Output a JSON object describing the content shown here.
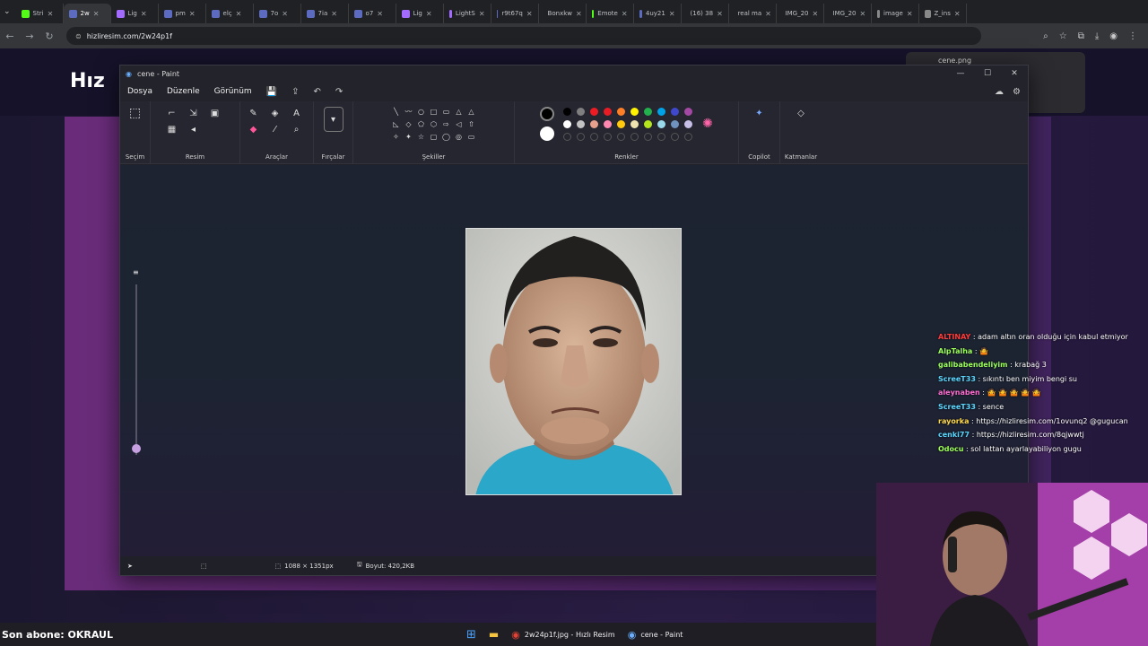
{
  "browser": {
    "tabs": [
      {
        "label": "Stri",
        "color": "#53fc18"
      },
      {
        "label": "2w",
        "color": "#5c6bc0",
        "active": true
      },
      {
        "label": "Lig",
        "color": "#a36bff"
      },
      {
        "label": "pm",
        "color": "#5c6bc0"
      },
      {
        "label": "elç",
        "color": "#5c6bc0"
      },
      {
        "label": "7o",
        "color": "#5c6bc0"
      },
      {
        "label": "7ia",
        "color": "#5c6bc0"
      },
      {
        "label": "o7",
        "color": "#5c6bc0"
      },
      {
        "label": "Lig",
        "color": "#a36bff"
      },
      {
        "label": "LightS",
        "color": "#a36bff"
      },
      {
        "label": "r9t67q",
        "color": "#5c6bc0"
      },
      {
        "label": "Bonxkw",
        "color": "#5c6bc0"
      },
      {
        "label": "Emote",
        "color": "#53fc18"
      },
      {
        "label": "4uy21",
        "color": "#5c6bc0"
      },
      {
        "label": "(16) 38",
        "color": "#ff0000"
      },
      {
        "label": "real ma",
        "color": "#ffffff"
      },
      {
        "label": "IMG_20",
        "color": "#888888"
      },
      {
        "label": "IMG_20",
        "color": "#888888"
      },
      {
        "label": "image",
        "color": "#888888"
      },
      {
        "label": "Z_ins",
        "color": "#888888"
      }
    ],
    "url": "hizliresim.com/2w24p1f"
  },
  "site": {
    "logo_text": "Hız",
    "download_file": "cene.png"
  },
  "paint": {
    "title": "cene - Paint",
    "menu": [
      "Dosya",
      "Düzenle",
      "Görünüm"
    ],
    "groups": {
      "selection": "Seçim",
      "image": "Resim",
      "tools": "Araçlar",
      "brushes": "Fırçalar",
      "shapes": "Şekiller",
      "colors": "Renkler",
      "copilot": "Copilot",
      "layers": "Katmanlar"
    },
    "palette_row1": [
      "#000000",
      "#7f7f7f",
      "#ed1c24",
      "#e81c24",
      "#ff7f27",
      "#fff200",
      "#22b14c",
      "#00a2e8",
      "#3f48cc",
      "#a349a4"
    ],
    "palette_row2": [
      "#ffffff",
      "#c3c3c3",
      "#e6a08c",
      "#ff88b0",
      "#ffc90e",
      "#efe4b0",
      "#b5e61d",
      "#99d9ea",
      "#7092be",
      "#c8bfe7"
    ],
    "status": {
      "dimensions": "1088 × 1351px",
      "size": "Boyut: 420,2KB"
    }
  },
  "chat": [
    {
      "user": "ALTINAY",
      "color": "#ff3b3b",
      "msg": ": adam altın oran olduğu için kabul etmiyor"
    },
    {
      "user": "AlpTalha",
      "color": "#9cff5a",
      "msg": ": 🤷"
    },
    {
      "user": "galibabendeliyim",
      "color": "#9cff5a",
      "msg": ": krabağ 3"
    },
    {
      "user": "ScreeT33",
      "color": "#5ad7ff",
      "msg": ": sıkıntı ben miyim bengi su"
    },
    {
      "user": "aleynaben",
      "color": "#ff6fd2",
      "msg": ": 🤷 🤷 🤷 🤷 🤷"
    },
    {
      "user": "ScreeT33",
      "color": "#5ad7ff",
      "msg": ": sence"
    },
    {
      "user": "rayorka",
      "color": "#ffd84a",
      "msg": ": https://hizliresim.com/1ovunq2 @gugucan"
    },
    {
      "user": "cenki77",
      "color": "#5ad7ff",
      "msg": ": https://hizliresim.com/8qjwwtj"
    },
    {
      "user": "Odocu",
      "color": "#9cff5a",
      "msg": ": sol lattan ayarlayabiliyon gugu"
    }
  ],
  "taskbar": {
    "subscriber": "Son abone: OKRAUL",
    "chrome_item": "2w24p1f.jpg - Hızlı Resim",
    "paint_item": "cene - Paint"
  }
}
